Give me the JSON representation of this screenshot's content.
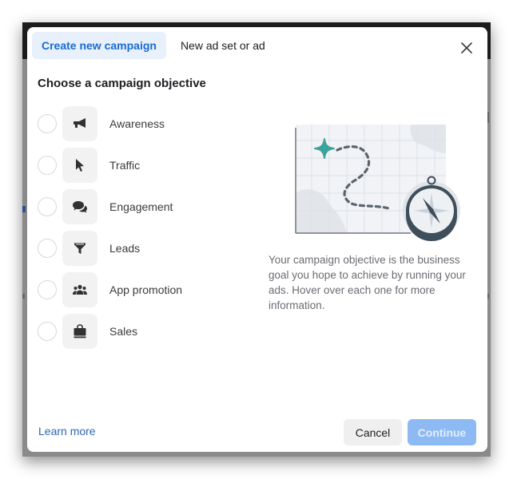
{
  "dialog": {
    "tabs": [
      {
        "label": "Create new campaign",
        "active": true
      },
      {
        "label": "New ad set or ad",
        "active": false
      }
    ],
    "close_icon": "close-icon",
    "heading": "Choose a campaign objective",
    "objectives": [
      {
        "label": "Awareness",
        "icon": "megaphone-icon",
        "selected": false
      },
      {
        "label": "Traffic",
        "icon": "cursor-icon",
        "selected": false
      },
      {
        "label": "Engagement",
        "icon": "chat-bubbles-icon",
        "selected": false
      },
      {
        "label": "Leads",
        "icon": "funnel-icon",
        "selected": false
      },
      {
        "label": "App promotion",
        "icon": "people-icon",
        "selected": false
      },
      {
        "label": "Sales",
        "icon": "shopping-bag-icon",
        "selected": false
      }
    ],
    "illustration": "map-and-compass-illustration",
    "description": "Your campaign objective is the business goal you hope to achieve by running your ads. Hover over each one for more information.",
    "footer": {
      "learn_more": "Learn more",
      "cancel": "Cancel",
      "continue": "Continue",
      "continue_disabled": true
    }
  },
  "colors": {
    "accent": "#1b6ccf",
    "active_tab_bg": "#e7f0fb",
    "continue_disabled_bg": "#8ebaf3",
    "illustration_teal": "#3aa39a",
    "compass_dark": "#3f4e5b"
  }
}
